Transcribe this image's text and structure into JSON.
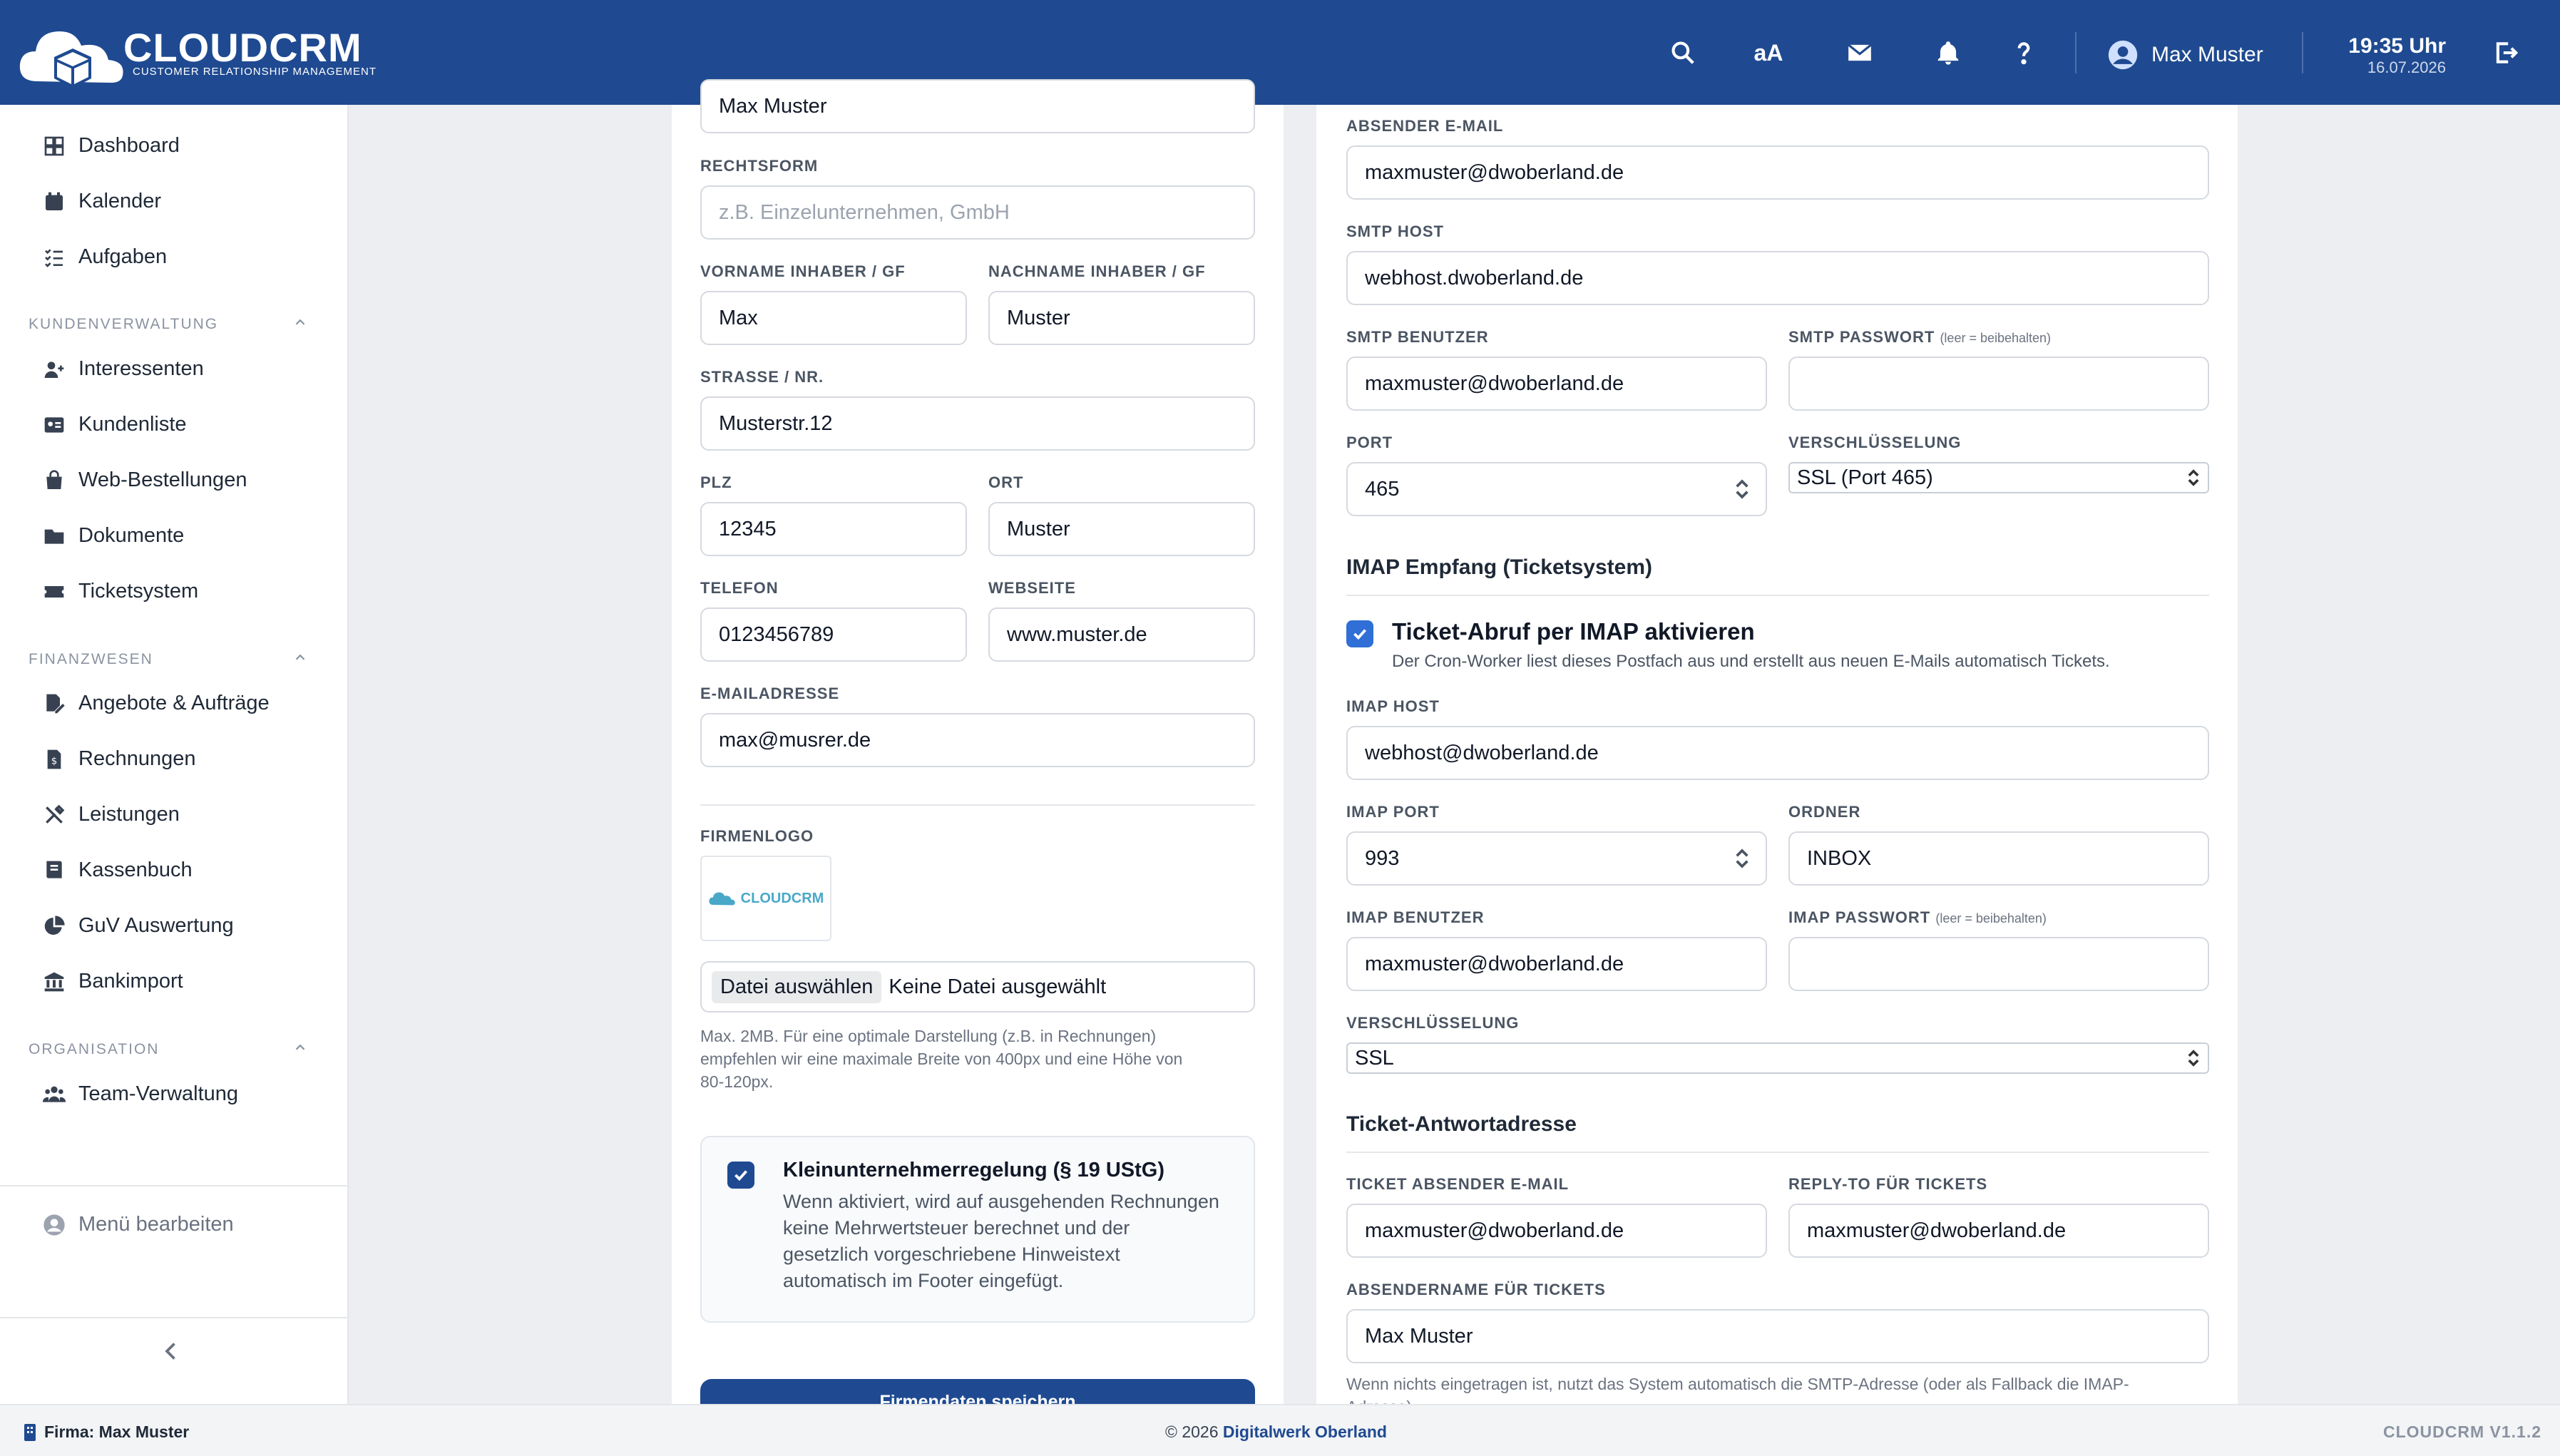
{
  "topbar": {
    "brand": "CLOUDCRM",
    "brand_sub": "CUSTOMER RELATIONSHIP MANAGEMENT",
    "font_toggle": "aA",
    "user_name": "Max Muster",
    "time": "19:35 Uhr",
    "date": "16.07.2026"
  },
  "sidebar": {
    "main": [
      "Dashboard",
      "Kalender",
      "Aufgaben"
    ],
    "sec1_title": "KUNDENVERWALTUNG",
    "sec1": [
      "Interessenten",
      "Kundenliste",
      "Web-Bestellungen",
      "Dokumente",
      "Ticketsystem"
    ],
    "sec2_title": "FINANZWESEN",
    "sec2": [
      "Angebote & Aufträge",
      "Rechnungen",
      "Leistungen",
      "Kassenbuch",
      "GuV Auswertung",
      "Bankimport"
    ],
    "sec3_title": "ORGANISATION",
    "sec3": [
      "Team-Verwaltung"
    ],
    "menu_edit": "Menü bearbeiten"
  },
  "left": {
    "firma_value": "Max Muster",
    "rechtsform_label": "RECHTSFORM",
    "rechtsform_placeholder": "z.B. Einzelunternehmen, GmbH",
    "vorname_label": "VORNAME INHABER / GF",
    "vorname": "Max",
    "nachname_label": "NACHNAME INHABER / GF",
    "nachname": "Muster",
    "strasse_label": "STRASSE / NR.",
    "strasse": "Musterstr.12",
    "plz_label": "PLZ",
    "plz": "12345",
    "ort_label": "ORT",
    "ort": "Muster",
    "telefon_label": "TELEFON",
    "telefon": "0123456789",
    "webseite_label": "WEBSEITE",
    "webseite": "www.muster.de",
    "email_label": "E-MAILADRESSE",
    "email": "max@musrer.de",
    "logo_label": "FIRMENLOGO",
    "logo_text": "CLOUDCRM",
    "file_button": "Datei auswählen",
    "file_status": "Keine Datei ausgewählt",
    "file_hint_1": "Max. 2MB. Für eine optimale Darstellung (z.B. in Rechnungen)",
    "file_hint_2": "empfehlen wir eine maximale Breite von 400px und eine Höhe von",
    "file_hint_3": "80-120px.",
    "klein_title": "Kleinunternehmerregelung (§ 19 UStG)",
    "klein_1": "Wenn aktiviert, wird auf ausgehenden Rechnungen",
    "klein_2": "keine Mehrwertsteuer berechnet und der",
    "klein_3": "gesetzlich vorgeschriebene Hinweistext",
    "klein_4": "automatisch im Footer eingefügt.",
    "save_button": "Firmendaten speichern"
  },
  "right": {
    "absender_label": "ABSENDER E-MAIL",
    "absender": "maxmuster@dwoberland.de",
    "smtp_host_label": "SMTP HOST",
    "smtp_host": "webhost.dwoberland.de",
    "smtp_user_label": "SMTP BENUTZER",
    "smtp_user": "maxmuster@dwoberland.de",
    "smtp_pw_label": "SMTP PASSWORT",
    "pw_hint": "(leer = beibehalten)",
    "port_label": "PORT",
    "port": "465",
    "verschl_label": "VERSCHLÜSSELUNG",
    "verschl": "SSL (Port 465)",
    "imap_title": "IMAP Empfang (Ticketsystem)",
    "imap_check": "Ticket-Abruf per IMAP aktivieren",
    "imap_check_desc": "Der Cron-Worker liest dieses Postfach aus und erstellt aus neuen E-Mails automatisch Tickets.",
    "imap_host_label": "IMAP HOST",
    "imap_host": "webhost@dwoberland.de",
    "imap_port_label": "IMAP PORT",
    "imap_port": "993",
    "ordner_label": "ORDNER",
    "ordner": "INBOX",
    "imap_user_label": "IMAP BENUTZER",
    "imap_user": "maxmuster@dwoberland.de",
    "imap_pw_label": "IMAP PASSWORT",
    "imap_verschl_label": "VERSCHLÜSSELUNG",
    "imap_verschl": "SSL",
    "ticket_title": "Ticket-Antwortadresse",
    "ticket_absender_label": "TICKET ABSENDER E-MAIL",
    "ticket_absender": "maxmuster@dwoberland.de",
    "reply_label": "REPLY-TO FÜR TICKETS",
    "reply": "maxmuster@dwoberland.de",
    "absendername_label": "ABSENDERNAME FÜR TICKETS",
    "absendername": "Max Muster",
    "absendername_hint": "Wenn nichts eingetragen ist, nutzt das System automatisch die SMTP-Adresse (oder als Fallback die IMAP-Adresse)."
  },
  "footer": {
    "firma": "Firma: Max Muster",
    "copyright": "© 2026",
    "company": "Digitalwerk Oberland",
    "version": "CLOUDCRM V1.1.2"
  }
}
